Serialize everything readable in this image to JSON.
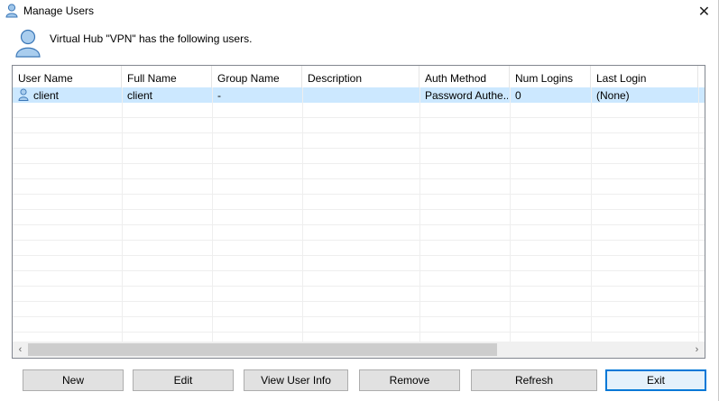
{
  "window": {
    "title": "Manage Users",
    "close_label": "✕"
  },
  "header": {
    "text": "Virtual Hub \"VPN\" has the following users."
  },
  "list": {
    "columns": [
      "User Name",
      "Full Name",
      "Group Name",
      "Description",
      "Auth Method",
      "Num Logins",
      "Last Login"
    ],
    "rows": [
      {
        "user_name": "client",
        "full_name": "client",
        "group_name": "-",
        "description": "",
        "auth_method": "Password Authe...",
        "num_logins": "0",
        "last_login": "(None)"
      }
    ]
  },
  "scrollbar": {
    "left_arrow": "‹",
    "right_arrow": "›"
  },
  "buttons": {
    "new": "New",
    "edit": "Edit",
    "view_user_info": "View User Info",
    "remove": "Remove",
    "refresh": "Refresh",
    "exit": "Exit"
  },
  "colors": {
    "selection": "#cce8ff",
    "default_button_border": "#0078d7"
  },
  "icons": {
    "title": "user-icon",
    "header": "user-icon",
    "row": "user-icon"
  }
}
